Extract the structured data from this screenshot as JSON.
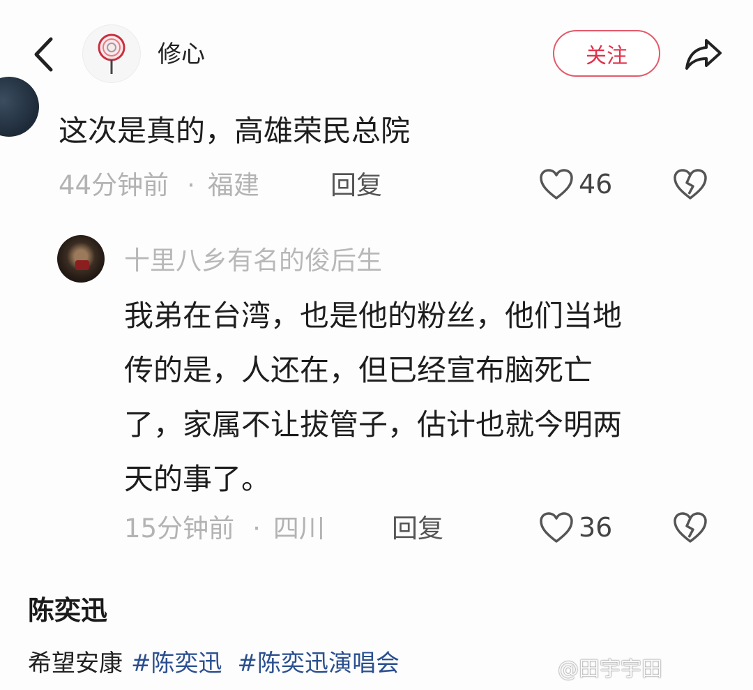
{
  "header": {
    "author_name": "修心",
    "follow_label": "关注",
    "icons": {
      "back": "back-arrow-icon",
      "share": "share-arrow-icon",
      "avatar": "lollipop-avatar"
    }
  },
  "comment": {
    "text": "这次是真的，高雄荣民总院",
    "time": "44分钟前",
    "separator": "·",
    "location": "福建",
    "reply_label": "回复",
    "likes": "46"
  },
  "reply_comment": {
    "author": "十里八乡有名的俊后生",
    "text_lines": [
      "我弟在台湾，也是他的粉丝，他们当地",
      "传的是，人还在，但已经宣布脑死亡",
      "了，家属不让拔管子，估计也就今明两",
      "天的事了。"
    ],
    "time": "15分钟前",
    "separator": "·",
    "location": "四川",
    "reply_label": "回复",
    "likes": "36"
  },
  "post": {
    "title": "陈奕迅",
    "desc": "希望安康",
    "tags": [
      "#陈奕迅",
      "#陈奕迅演唱会"
    ]
  },
  "watermark": "@田宇宇田",
  "colors": {
    "accent_red": "#e0314a",
    "tag_blue": "#2a4f8f",
    "meta_gray": "#b3b3b3"
  }
}
